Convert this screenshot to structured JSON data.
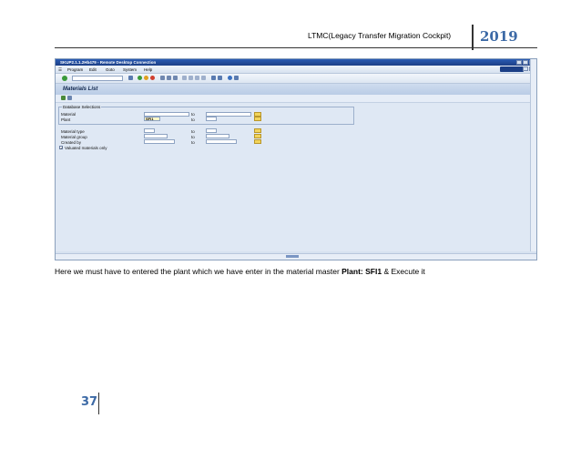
{
  "header": {
    "title": "LTMC(Legacy Transfer Migration Cockpit)",
    "year": "2019"
  },
  "screenshot": {
    "window_title": "SKUP2.1.1.2Hb479 - Remote Desktop Connection",
    "menu": [
      "Program",
      "Edit",
      "Goto",
      "System",
      "Help"
    ],
    "page_title": "Materials List",
    "group_title": "Database Selections",
    "fields": {
      "material_label": "Material",
      "plant_label": "Plant",
      "plant_value": "SFI1",
      "material_type_label": "Material type",
      "material_group_label": "Material group",
      "created_by_label": "Created by",
      "to_label": "to",
      "valuated_only_label": "Valuated materials only",
      "valuated_only_checked": true
    },
    "colors": {
      "titlebar": "#1c3f86",
      "background": "#dfe8f4",
      "accent": "#3d6aa6"
    }
  },
  "caption": {
    "text_before": "Here we must have to  entered the plant which we have enter in the material master ",
    "bold": "Plant: SFI1",
    "text_after": " & Execute it"
  },
  "footer": {
    "page_number": "37"
  }
}
